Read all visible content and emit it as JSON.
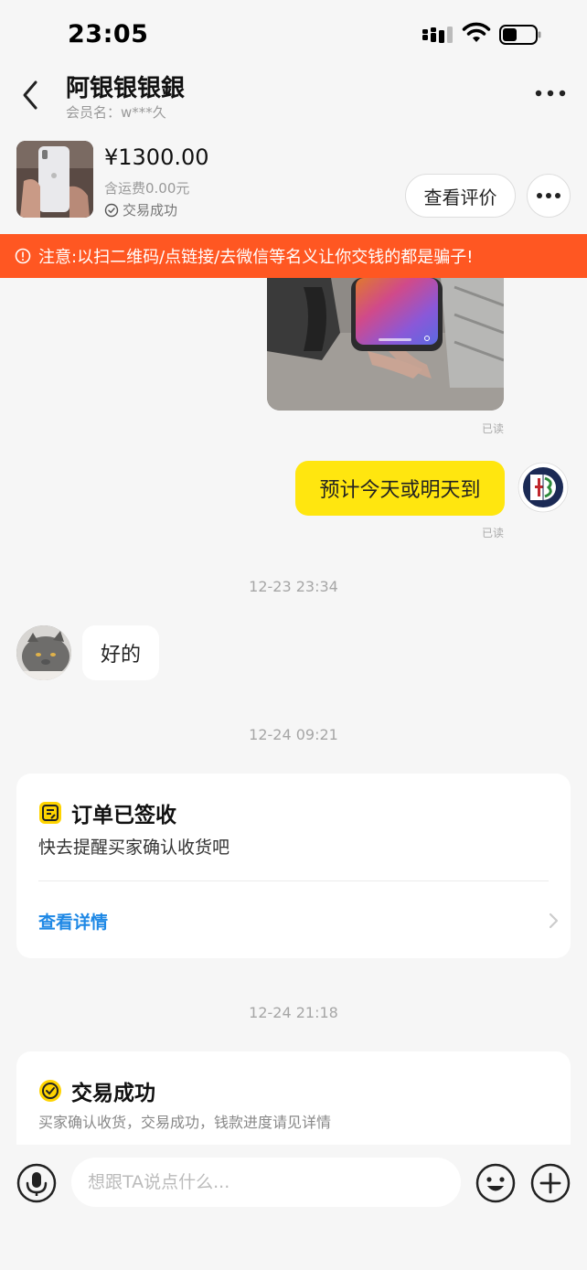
{
  "status_bar": {
    "time": "23:05"
  },
  "header": {
    "title": "阿银银银銀",
    "member_label": "会员名：w***久"
  },
  "product": {
    "price": "¥1300.00",
    "shipping": "含运费0.00元",
    "status": "交易成功",
    "review_button": "查看评价"
  },
  "warning": {
    "text": "注意:以扫二维码/点链接/去微信等名义让你交钱的都是骗子!"
  },
  "chat": {
    "read_label_1": "已读",
    "my_message": "预计今天或明天到",
    "read_label_2": "已读",
    "time_1": "12-23 23:34",
    "their_message": "好的",
    "time_2": "12-24 09:21",
    "time_3": "12-24 21:18"
  },
  "cards": [
    {
      "title": "订单已签收",
      "subtitle": "快去提醒买家确认收货吧",
      "link": "查看详情"
    },
    {
      "title": "交易成功",
      "subtitle": "买家确认收货，交易成功，钱款进度请见详情"
    }
  ],
  "input": {
    "placeholder": "想跟TA说点什么..."
  },
  "colors": {
    "accent_yellow": "#ffe60f",
    "warning_orange": "#ff5722",
    "link_blue": "#1e88e5"
  }
}
